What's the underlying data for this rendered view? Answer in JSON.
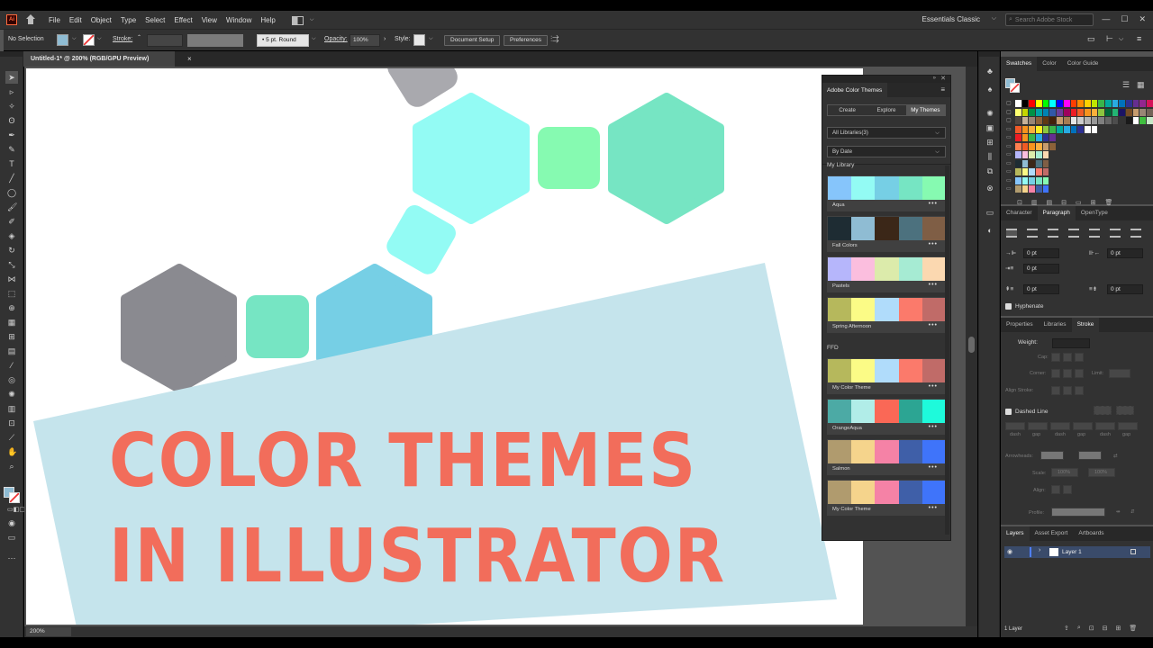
{
  "menubar": {
    "app_logo": "Ai",
    "items": [
      "File",
      "Edit",
      "Object",
      "Type",
      "Select",
      "Effect",
      "View",
      "Window",
      "Help"
    ],
    "workspace": "Essentials Classic",
    "stock_search_placeholder": "Search Adobe Stock",
    "icons": [
      "home-icon",
      "arrange-documents-icon",
      "search-icon",
      "minimize-icon",
      "maximize-icon",
      "close-icon"
    ]
  },
  "control_bar": {
    "selection": "No Selection",
    "stroke_label": "Stroke:",
    "brush": "5 pt. Round",
    "opacity_label": "Opacity:",
    "opacity_value": "100%",
    "style_label": "Style:",
    "document_setup": "Document Setup",
    "preferences": "Preferences",
    "fill_color": "#8fbcd3"
  },
  "document": {
    "tab_title": "Untitled-1* @ 200% (RGB/GPU Preview)",
    "close": "×",
    "zoom": "200%"
  },
  "artwork": {
    "headline_line1": "COLOR THEMES",
    "headline_line2": "IN ILLUSTRATOR",
    "headline_color": "#f26d5b",
    "banner_color": "#c5e4ec",
    "shape_colors": {
      "grey": "#8a8a90",
      "cyan": "#93fbf4",
      "mint": "#86fab1",
      "teal": "#76e5c3",
      "sky": "#76cfe5",
      "grey_light": "#a9a9ae"
    }
  },
  "color_themes_panel": {
    "title": "Adobe Color Themes",
    "tabs": [
      "Create",
      "Explore",
      "My Themes"
    ],
    "active_tab": "My Themes",
    "library_filter": "All Libraries(3)",
    "sort": "By Date",
    "more": "•••",
    "sections": [
      {
        "label": "My Library",
        "themes": [
          {
            "name": "Aqua",
            "colors": [
              "#86c5fb",
              "#93fbf4",
              "#76cfe5",
              "#76e5c3",
              "#86fab1"
            ]
          },
          {
            "name": "Fall Colors",
            "colors": [
              "#1e2c33",
              "#8fbcd3",
              "#3b2718",
              "#4c717e",
              "#7f5e45"
            ]
          },
          {
            "name": "Pastels",
            "colors": [
              "#b6b6fb",
              "#fbbede",
              "#dcebab",
              "#a6ebd3",
              "#fbd8b0"
            ]
          },
          {
            "name": "Spring Afternoon",
            "colors": [
              "#b6b85c",
              "#fbfb86",
              "#b0dcfb",
              "#fb7a6b",
              "#c06b68"
            ]
          }
        ]
      },
      {
        "label": "FFD",
        "themes": [
          {
            "name": "My Color Theme",
            "colors": [
              "#b6b85c",
              "#fbfb86",
              "#b0dcfb",
              "#fb7a6b",
              "#c06b68"
            ]
          },
          {
            "name": "OrangeAqua",
            "colors": [
              "#4caaa5",
              "#b1ede8",
              "#fa6856",
              "#2ca593",
              "#1efadb"
            ]
          },
          {
            "name": "Salmon",
            "colors": [
              "#b09b6e",
              "#f5d48c",
              "#f582a6",
              "#3f5fa8",
              "#3f74fa"
            ]
          },
          {
            "name": "My Color Theme",
            "colors": [
              "#b09b6e",
              "#f5d48c",
              "#f582a6",
              "#3f5fa8",
              "#3f74fa"
            ]
          }
        ]
      }
    ]
  },
  "swatches_panel": {
    "tabs": [
      "Swatches",
      "Color",
      "Color Guide"
    ],
    "active_tab": "Swatches",
    "rows": [
      [
        "#ffffff",
        "#000000",
        "#ff0000",
        "#ffff00",
        "#00ff00",
        "#00ffff",
        "#0000ff",
        "#ff00ff",
        "#ff3e00",
        "#ff8a00",
        "#ffd000",
        "#bfe600",
        "#39b54a",
        "#00a99d",
        "#29abe2",
        "#0071bc",
        "#2e3192",
        "#662d91",
        "#93278f",
        "#d4145a"
      ],
      [
        "#ffff70",
        "#c4d600",
        "#009245",
        "#00a3a3",
        "#0083b3",
        "#3258a8",
        "#6a3d9a",
        "#9e005d",
        "#ed1c24",
        "#f15a24",
        "#f7931e",
        "#fbb03b",
        "#8cc63f",
        "#006837",
        "#22b573",
        "#1b1464",
        "#754c24",
        "#c69c6d",
        "#998675",
        "#736357"
      ],
      [
        "#534741",
        "#c7b299",
        "#998675",
        "#8c6239",
        "#603813",
        "#42210b",
        "#c69c6d",
        "#a67c52",
        "#e6e6e6",
        "#cccccc",
        "#b3b3b3",
        "#999999",
        "#808080",
        "#666666",
        "#4d4d4d",
        "#333333",
        "#1a1a1a",
        "#ffffff",
        "#3fbf3f",
        "#c8e8c8"
      ],
      [
        "#f05a28",
        "#f7931e",
        "#fbb03b",
        "#fcee21",
        "#8cc63f",
        "#39b54a",
        "#00a99d",
        "#29abe2",
        "#0071bc",
        "#2e3192",
        "#ffffff",
        "#ffffff"
      ],
      [
        "#ed1c24",
        "#f7931e",
        "#39b54a",
        "#29abe2",
        "#2e3192",
        "#662d91"
      ],
      [
        "#ff7f50",
        "#f15a24",
        "#f7941d",
        "#fbb040",
        "#c69c6d",
        "#8c6239"
      ],
      [
        "#b6b6fb",
        "#fbbede",
        "#dcebab",
        "#a6ebd3",
        "#fbd8b0"
      ],
      [
        "#1e2c33",
        "#8fbcd3",
        "#3b2718",
        "#4c717e",
        "#7f5e45"
      ],
      [
        "#b6b85c",
        "#fbfb86",
        "#b0dcfb",
        "#fb7a6b",
        "#c06b68"
      ],
      [
        "#86c5fb",
        "#93fbf4",
        "#76cfe5",
        "#76e5c3",
        "#86fab1"
      ],
      [
        "#b09b6e",
        "#f5d48c",
        "#f582a6",
        "#3f5fa8",
        "#3f74fa"
      ]
    ]
  },
  "paragraph_panel": {
    "tabs": [
      "Character",
      "Paragraph",
      "OpenType"
    ],
    "active_tab": "Paragraph",
    "left_indent": "0 pt",
    "right_indent": "0 pt",
    "first_line": "0 pt",
    "space_before": "0 pt",
    "space_after": "0 pt",
    "hyphenate": "Hyphenate"
  },
  "stroke_panel": {
    "tabs": [
      "Properties",
      "Libraries",
      "Stroke"
    ],
    "active_tab": "Stroke",
    "weight_label": "Weight:",
    "cap_label": "Cap:",
    "corner_label": "Corner:",
    "limit_label": "Limit:",
    "align_label": "Align Stroke:",
    "dashed_line": "Dashed Line",
    "dash_labels": [
      "dash",
      "gap",
      "dash",
      "gap",
      "dash",
      "gap"
    ],
    "arrowheads_label": "Arrowheads:",
    "scale_label": "Scale:",
    "scale_value": "100%",
    "align_arrow_label": "Align:",
    "profile_label": "Profile:"
  },
  "layers_panel": {
    "tabs": [
      "Layers",
      "Asset Export",
      "Artboards"
    ],
    "active_tab": "Layers",
    "layer_name": "Layer 1",
    "count": "1 Layer",
    "layer_color": "#4f7fff"
  }
}
